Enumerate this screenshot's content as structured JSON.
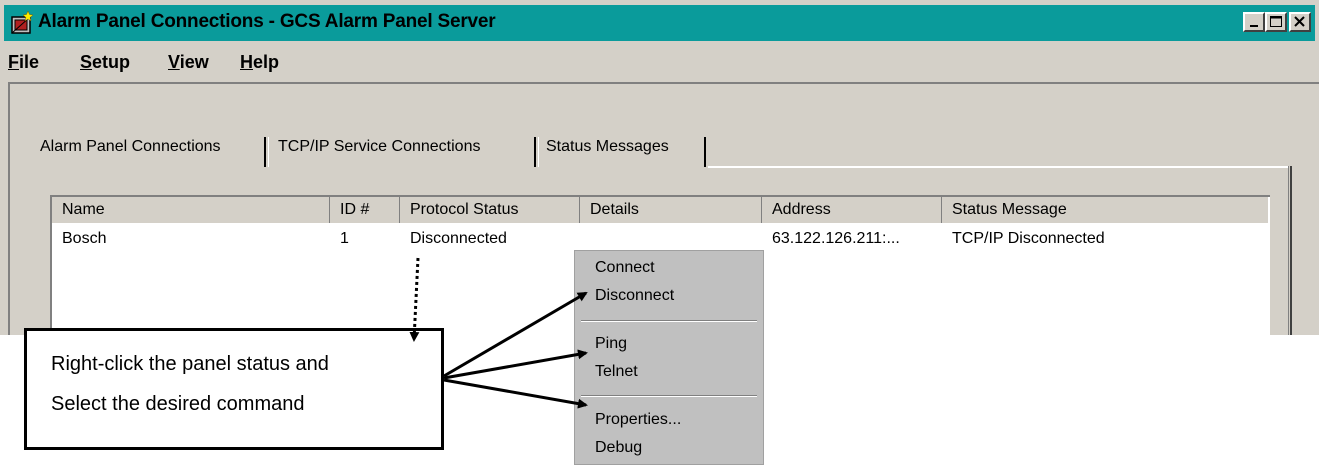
{
  "window": {
    "title": "Alarm Panel Connections - GCS Alarm Panel Server",
    "title_bar_color": "#0a9b9b",
    "controls": [
      "minimize-icon",
      "maximize-icon",
      "close-icon"
    ]
  },
  "menu": {
    "items": [
      {
        "key": "F",
        "rest": "ile"
      },
      {
        "key": "S",
        "rest": "etup"
      },
      {
        "key": "V",
        "rest": "iew"
      },
      {
        "key": "H",
        "rest": "elp"
      }
    ]
  },
  "tabs": [
    {
      "label": "Alarm Panel Connections"
    },
    {
      "label": "TCP/IP Service Connections"
    },
    {
      "label": "Status Messages"
    }
  ],
  "table": {
    "columns": [
      "Name",
      "ID #",
      "Protocol Status",
      "Details",
      "Address",
      "Status Message"
    ],
    "rows": [
      [
        "Bosch",
        "1",
        "Disconnected",
        "",
        "63.122.126.211:...",
        "TCP/IP Disconnected"
      ]
    ]
  },
  "context_menu": {
    "items": [
      "Connect",
      "Disconnect",
      "Ping",
      "Telnet",
      "Properties...",
      "Debug"
    ]
  },
  "callout": {
    "line1": "Right-click the panel status and",
    "line2": "Select the desired command"
  }
}
